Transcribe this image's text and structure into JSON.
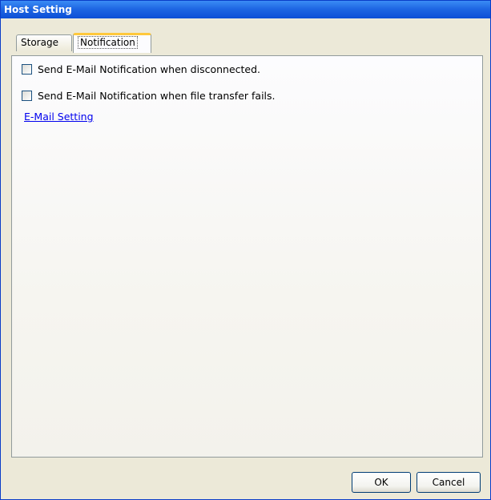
{
  "window": {
    "title": "Host Setting"
  },
  "tabs": [
    {
      "label": "Storage",
      "active": false
    },
    {
      "label": "Notification",
      "active": true
    }
  ],
  "notification": {
    "options": [
      {
        "label": "Send E-Mail Notification when disconnected.",
        "checked": false
      },
      {
        "label": "Send E-Mail Notification when file transfer fails.",
        "checked": false
      }
    ],
    "email_setting_link": "E-Mail Setting"
  },
  "buttons": {
    "ok": "OK",
    "cancel": "Cancel"
  },
  "colors": {
    "titlebar": "#0d4fd6",
    "link": "#0000ee",
    "active_tab_highlight": "#ffc83c"
  }
}
